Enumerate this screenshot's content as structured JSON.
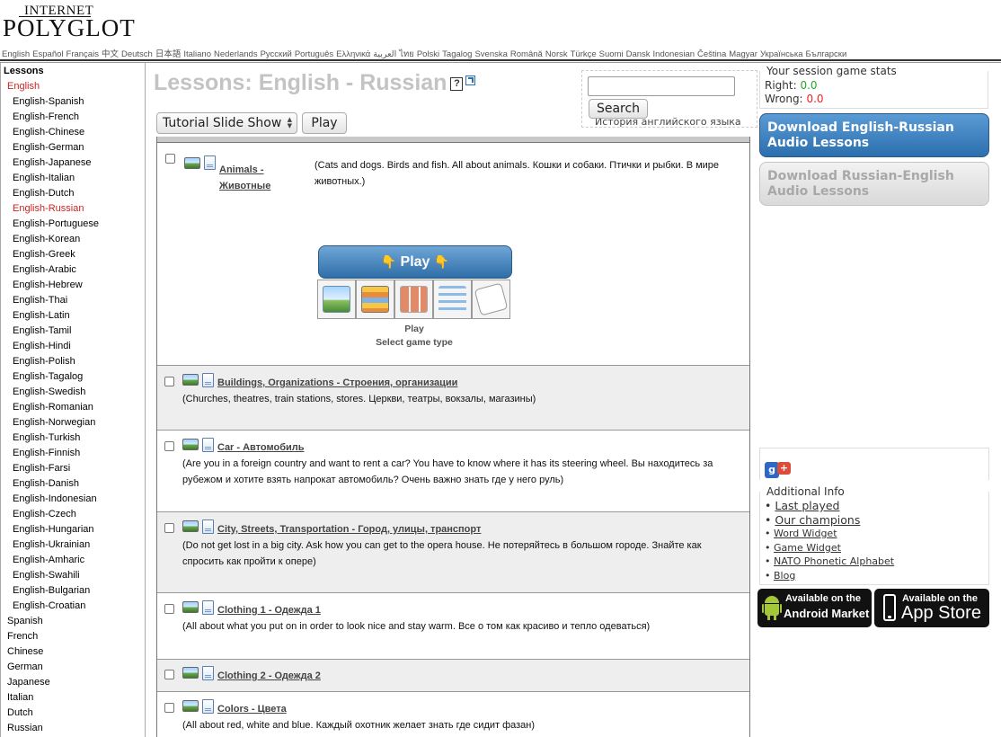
{
  "logo": {
    "line1": "INTERNET",
    "line2": "POLYGLOT"
  },
  "languages": [
    "English",
    "Español",
    "Français",
    "中文",
    "Deutsch",
    "日本語",
    "Italiano",
    "Nederlands",
    "Русский",
    "Português",
    "Ελληνικά",
    "العربية",
    "ไทย",
    "Polski",
    "Tagalog",
    "Svenska",
    "Română",
    "Norsk",
    "Türkçe",
    "Suomi",
    "Dansk",
    "Indonesian",
    "Čeština",
    "Magyar",
    "Українська",
    "Български"
  ],
  "sidebar": {
    "heading": "Lessons",
    "items": [
      {
        "label": "English",
        "level": 0,
        "active": true
      },
      {
        "label": "English-Spanish",
        "level": 1
      },
      {
        "label": "English-French",
        "level": 1
      },
      {
        "label": "English-Chinese",
        "level": 1
      },
      {
        "label": "English-German",
        "level": 1
      },
      {
        "label": "English-Japanese",
        "level": 1
      },
      {
        "label": "English-Italian",
        "level": 1
      },
      {
        "label": "English-Dutch",
        "level": 1
      },
      {
        "label": "English-Russian",
        "level": 1,
        "active": true
      },
      {
        "label": "English-Portuguese",
        "level": 1
      },
      {
        "label": "English-Korean",
        "level": 1
      },
      {
        "label": "English-Greek",
        "level": 1
      },
      {
        "label": "English-Arabic",
        "level": 1
      },
      {
        "label": "English-Hebrew",
        "level": 1
      },
      {
        "label": "English-Thai",
        "level": 1
      },
      {
        "label": "English-Latin",
        "level": 1
      },
      {
        "label": "English-Tamil",
        "level": 1
      },
      {
        "label": "English-Hindi",
        "level": 1
      },
      {
        "label": "English-Polish",
        "level": 1
      },
      {
        "label": "English-Tagalog",
        "level": 1
      },
      {
        "label": "English-Swedish",
        "level": 1
      },
      {
        "label": "English-Romanian",
        "level": 1
      },
      {
        "label": "English-Norwegian",
        "level": 1
      },
      {
        "label": "English-Turkish",
        "level": 1
      },
      {
        "label": "English-Finnish",
        "level": 1
      },
      {
        "label": "English-Farsi",
        "level": 1
      },
      {
        "label": "English-Danish",
        "level": 1
      },
      {
        "label": "English-Indonesian",
        "level": 1
      },
      {
        "label": "English-Czech",
        "level": 1
      },
      {
        "label": "English-Hungarian",
        "level": 1
      },
      {
        "label": "English-Ukrainian",
        "level": 1
      },
      {
        "label": "English-Amharic",
        "level": 1
      },
      {
        "label": "English-Swahili",
        "level": 1
      },
      {
        "label": "English-Bulgarian",
        "level": 1
      },
      {
        "label": "English-Croatian",
        "level": 1
      },
      {
        "label": "Spanish",
        "level": 0
      },
      {
        "label": "French",
        "level": 0
      },
      {
        "label": "Chinese",
        "level": 0
      },
      {
        "label": "German",
        "level": 0
      },
      {
        "label": "Japanese",
        "level": 0
      },
      {
        "label": "Italian",
        "level": 0
      },
      {
        "label": "Dutch",
        "level": 0
      },
      {
        "label": "Russian",
        "level": 0
      }
    ]
  },
  "main": {
    "title": "Lessons: English - Russian",
    "help_glyph": "?",
    "select_value": "Tutorial Slide Show",
    "play_label": "Play"
  },
  "search": {
    "placeholder": "",
    "button": "Search",
    "behind_text": "История английского языка"
  },
  "lessons": [
    {
      "title": "Animals - Животные",
      "desc": "(Cats and dogs. Birds and fish. All about animals. Кошки и собаки. Птички и рыбки. В мире животных.)"
    },
    {
      "title": "Buildings, Organizations - Строения, организации",
      "desc": "(Churches, theatres, train stations, stores. Церкви, театры, вокзалы, магазины)"
    },
    {
      "title": "Car - Автомобиль",
      "desc": "(Are you in a foreign country and want to rent a car? You have to know where it has its steering wheel. Вы находитесь за рубежом и хотите взять напрокат автомобиль? Очень важно знать где у него руль)"
    },
    {
      "title": "City, Streets, Transportation - Город, улицы, транспорт",
      "desc": "(Do not get lost in a big city. Ask how you can get to the opera house. Не потеряйтесь в большом городе. Знайте как спросить как пройти к опере)"
    },
    {
      "title": "Clothing 1 - Одежда 1",
      "desc": "(All about what you put on in order to look nice and stay warm. Все о том как красиво и тепло одеваться)"
    },
    {
      "title": "Clothing 2 - Одежда 2",
      "desc": ""
    },
    {
      "title": "Colors - Цвета",
      "desc": "(All about red, white and blue. Каждый охотник желает знать где сидит фазан)"
    }
  ],
  "game_panel": {
    "play_button": "Play",
    "play_label": "Play",
    "select_label": "Select game type",
    "game_icons": [
      "picture-game-icon",
      "layers-game-icon",
      "tiles-game-icon",
      "list-game-icon",
      "dice-game-icon"
    ]
  },
  "stats": {
    "legend": "Your session game stats",
    "right_label": "Right:",
    "right_value": "0.0",
    "wrong_label": "Wrong:",
    "wrong_value": "0.0",
    "right_color": "#22aa22",
    "wrong_color": "#ee2222"
  },
  "downloads": {
    "primary": "Download English-Russian Audio Lessons",
    "secondary": "Download Russian-English Audio Lessons"
  },
  "additional_info": {
    "legend": "Additional Info",
    "links": [
      {
        "label": "Last played",
        "size": "big"
      },
      {
        "label": "Our champions",
        "size": "big"
      },
      {
        "label": "Word Widget",
        "size": "small"
      },
      {
        "label": "Game Widget",
        "size": "small"
      },
      {
        "label": "NATO Phonetic Alphabet",
        "size": "small"
      },
      {
        "label": "Blog",
        "size": "small"
      }
    ]
  },
  "badges": {
    "android_top": "Available on the",
    "android_bottom": "Android Market",
    "apple_top": "Available on the",
    "apple_bottom": "App Store"
  }
}
